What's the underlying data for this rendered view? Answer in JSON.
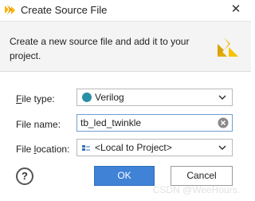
{
  "window": {
    "title": "Create Source File",
    "close_glyph": "✕"
  },
  "header": {
    "description": "Create a new source file and add it to your project.",
    "logo_icon": "vivado-logo-icon"
  },
  "form": {
    "file_type": {
      "label_mnemonic": "F",
      "label_rest": "ile type:",
      "value": "Verilog",
      "icon": "verilog-dot-icon",
      "icon_color": "#2a8fa6"
    },
    "file_name": {
      "label_mnemonic": "",
      "label_rest": "File name:",
      "value": "tb_led_twinkle"
    },
    "file_location": {
      "label_before": "File ",
      "label_mnemonic": "l",
      "label_rest": "ocation:",
      "value": "<Local to Project>",
      "icon": "local-project-icon"
    }
  },
  "footer": {
    "help_label": "?",
    "ok_label": "OK",
    "cancel_label": "Cancel"
  },
  "watermark": "CSDN @WeeHours."
}
